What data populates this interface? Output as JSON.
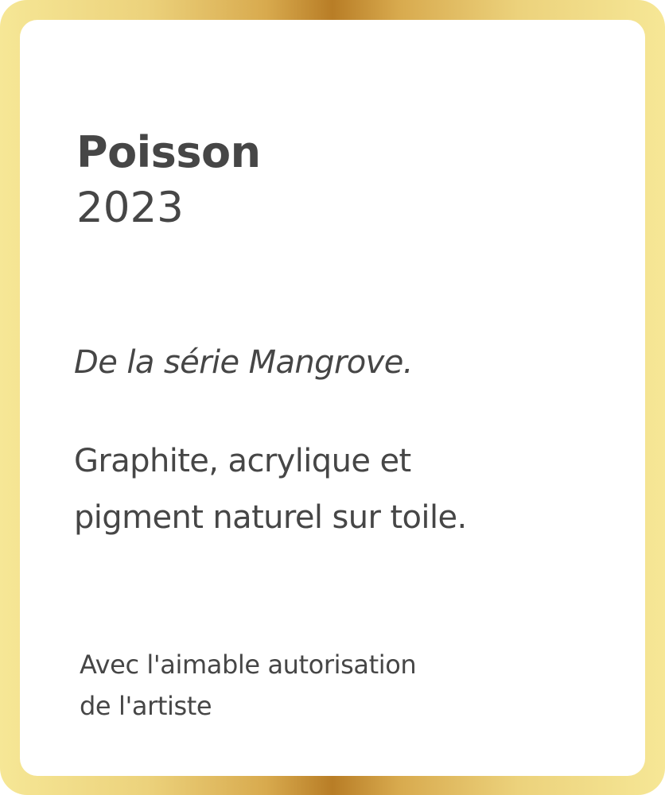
{
  "label": {
    "title": "Poisson",
    "year": "2023",
    "series": "De la série Mangrove.",
    "medium_lines": [
      "Graphite, acrylique et",
      "pigment naturel sur toile."
    ],
    "credit_lines": [
      "Avec l'aimable autorisation",
      "de l'artiste"
    ]
  },
  "colors": {
    "text": "#464646",
    "frame_light": "#f6e796",
    "frame_dark": "#b87d26",
    "card": "#ffffff"
  }
}
